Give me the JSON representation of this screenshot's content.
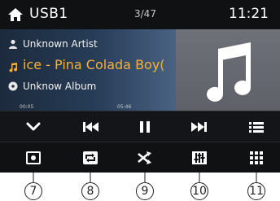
{
  "header": {
    "source": "USB1",
    "track_position": "3/47",
    "clock": "11:21"
  },
  "track": {
    "artist": "Unknown Artist",
    "title": "ice - Pina Colada Boy(",
    "album": "Unknow Album",
    "elapsed": "00:05",
    "total": "05:46"
  },
  "controls": [
    "chevron-down-icon",
    "previous-track-icon",
    "pause-icon",
    "next-track-icon",
    "playlist-icon"
  ],
  "functions": [
    "function-7-icon",
    "repeat-icon",
    "shuffle-icon",
    "equalizer-icon",
    "grid-menu-icon"
  ],
  "callouts": [
    "7",
    "8",
    "9",
    "10",
    "11"
  ],
  "colors": {
    "accent": "#f7b03a",
    "background": "#1a1c20",
    "bar": "#101113"
  }
}
